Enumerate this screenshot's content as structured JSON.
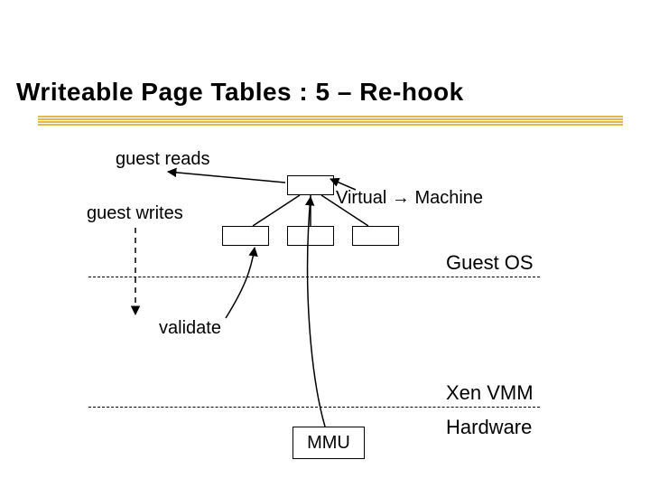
{
  "title": "Writeable Page Tables : 5 – Re-hook",
  "labels": {
    "guest_reads": "guest reads",
    "guest_writes": "guest writes",
    "virtual_machine": "Virtual → Machine",
    "validate": "validate"
  },
  "areas": {
    "guest_os": "Guest OS",
    "xen_vmm": "Xen VMM",
    "hardware": "Hardware"
  },
  "boxes": {
    "mmu": "MMU"
  }
}
